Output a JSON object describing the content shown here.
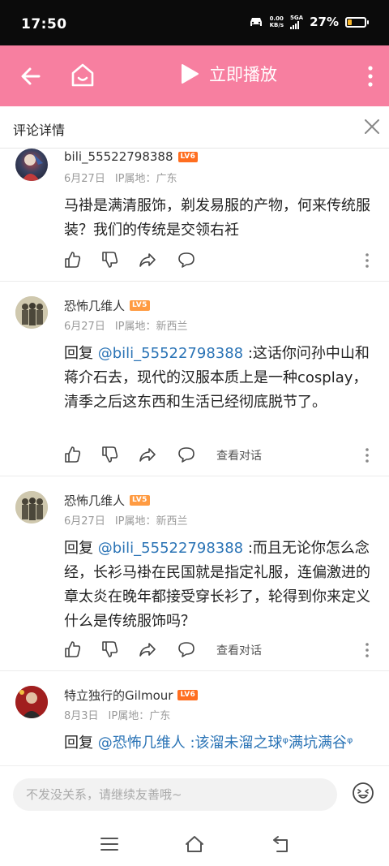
{
  "status_bar": {
    "time": "17:50",
    "net_speed_value": "0.00",
    "net_speed_unit": "KB/s",
    "signal_label": "5GA",
    "battery": "27%",
    "battery_level": 0.27
  },
  "top_bar": {
    "play_label": "立即播放",
    "accent": "#f77fa0"
  },
  "detail_header": {
    "title": "评论详情"
  },
  "comments": [
    {
      "user": "bili_55522798388",
      "level": "LV6",
      "level_color": "#ff6e20",
      "date": "6月27日",
      "ip": "IP属地：广东",
      "prefix": "",
      "mention": "",
      "text": "马褂是满清服饰，剃发易服的产物，何来传统服装？我们的传统是交领右衽",
      "view_conversation": ""
    },
    {
      "user": "恐怖几维人",
      "level": "LV5",
      "level_color": "#ff9b42",
      "date": "6月27日",
      "ip": "IP属地：新西兰",
      "prefix": "回复 ",
      "mention": "@bili_55522798388",
      "text": " :这话你问孙中山和蒋介石去，现代的汉服本质上是一种cosplay，清季之后这东西和生活已经彻底脱节了。",
      "view_conversation": "查看对话"
    },
    {
      "user": "恐怖几维人",
      "level": "LV5",
      "level_color": "#ff9b42",
      "date": "6月27日",
      "ip": "IP属地：新西兰",
      "prefix": "回复 ",
      "mention": "@bili_55522798388",
      "text": " :而且无论你怎么念经，长衫马褂在民国就是指定礼服，连偏激进的章太炎在晚年都接受穿长衫了，轮得到你来定义什么是传统服饰吗？",
      "view_conversation": "查看对话"
    },
    {
      "user": "特立独行的Gilmour",
      "level": "LV6",
      "level_color": "#ff6e20",
      "date": "8月3日",
      "ip": "IP属地：广东",
      "prefix": "回复 ",
      "mention": "@恐怖几维人",
      "text": " :该溜未溜之球ᵠ满坑满谷ᵠ",
      "view_conversation": ""
    }
  ],
  "reply_bar": {
    "placeholder": "不发没关系，请继续友善哦~"
  }
}
